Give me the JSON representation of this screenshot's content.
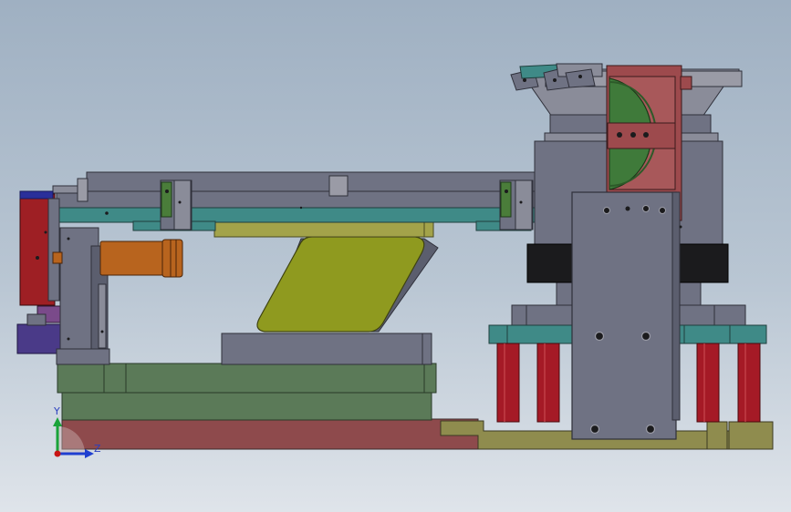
{
  "view": {
    "background_top": "#9fb0c2",
    "background_bottom": "#dfe4ea"
  },
  "triad": {
    "y_label": "Y",
    "z_label": "Z",
    "y_color": "#1aa33a",
    "z_color": "#1f3fd0",
    "origin_color": "#c81414"
  },
  "colors": {
    "base_red": "#8e4a4c",
    "base_olive": "#8f8c4e",
    "plate_green": "#5b7a58",
    "steel_dark": "#5b5e6e",
    "steel": "#6f7283",
    "steel_light": "#9a9ba6",
    "teal": "#3f8a87",
    "yellow_olive": "#a3a34a",
    "cam_yellow": "#8f9a1f",
    "cylinder_orange": "#b8641e",
    "red_column": "#a51a26",
    "black_block": "#1b1b1d",
    "green_disc": "#3f7a3a",
    "rust_frame": "#9d4a4d",
    "maroon": "#9e1f24",
    "purple": "#5a3a86"
  }
}
